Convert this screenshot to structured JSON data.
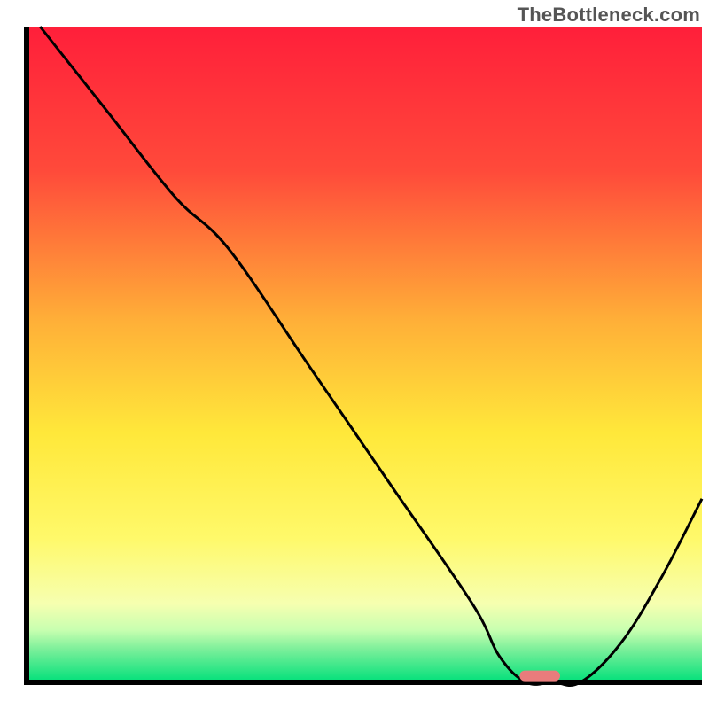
{
  "watermark": "TheBottleneck.com",
  "chart_data": {
    "type": "line",
    "title": "",
    "xlabel": "",
    "ylabel": "",
    "xlim": [
      0,
      100
    ],
    "ylim": [
      0,
      100
    ],
    "grid": false,
    "series": [
      {
        "name": "curve",
        "x": [
          2,
          12,
          22,
          30,
          42,
          54,
          66,
          70,
          74,
          78,
          82,
          88,
          94,
          100
        ],
        "y": [
          100,
          87,
          74,
          66,
          48,
          30,
          12,
          4,
          0,
          0,
          0,
          6,
          16,
          28
        ]
      }
    ],
    "marker": {
      "x_start": 73,
      "x_end": 79,
      "y": 1
    },
    "gradient_stops": [
      [
        "0%",
        "#ff1f3a"
      ],
      [
        "22%",
        "#ff4a3a"
      ],
      [
        "45%",
        "#ffb038"
      ],
      [
        "62%",
        "#ffe83a"
      ],
      [
        "78%",
        "#fff96a"
      ],
      [
        "88%",
        "#f6ffb0"
      ],
      [
        "92%",
        "#c8ffb0"
      ],
      [
        "95%",
        "#7aef9a"
      ],
      [
        "100%",
        "#00e07a"
      ]
    ],
    "colors": {
      "curve": "#000000",
      "marker": "#e97c7c",
      "axis": "#000000",
      "background_outside": "#ffffff"
    }
  }
}
